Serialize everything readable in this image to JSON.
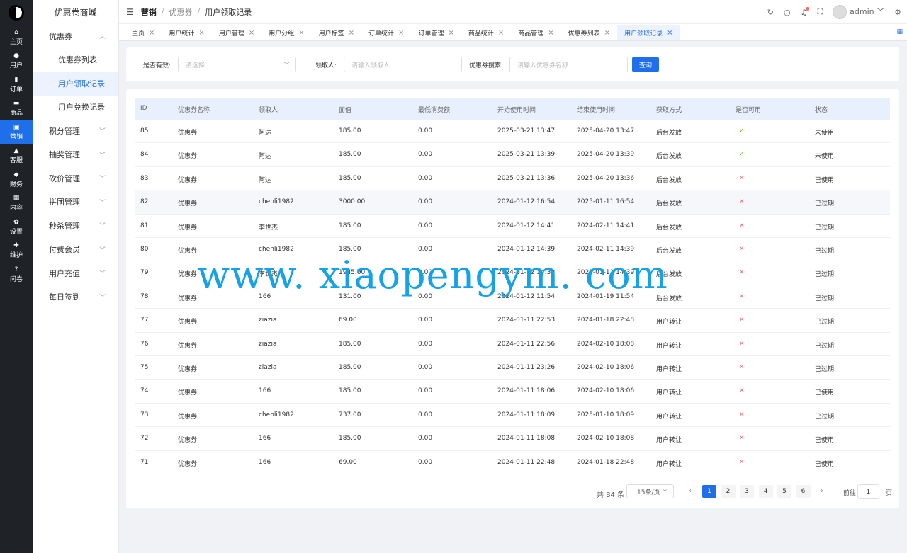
{
  "app": {
    "name": "优惠卷商城"
  },
  "rail": [
    {
      "label": "主页",
      "icon": "home-icon",
      "glyph": "⌂"
    },
    {
      "label": "用户",
      "icon": "user-icon",
      "glyph": "●"
    },
    {
      "label": "订单",
      "icon": "order-icon",
      "glyph": "▮"
    },
    {
      "label": "商品",
      "icon": "product-icon",
      "glyph": "▬"
    },
    {
      "label": "营销",
      "icon": "marketing-icon",
      "glyph": "▣"
    },
    {
      "label": "客服",
      "icon": "service-icon",
      "glyph": "▲"
    },
    {
      "label": "财务",
      "icon": "finance-icon",
      "glyph": "◆"
    },
    {
      "label": "内容",
      "icon": "content-icon",
      "glyph": "▦"
    },
    {
      "label": "设置",
      "icon": "settings-icon",
      "glyph": "✿"
    },
    {
      "label": "维护",
      "icon": "maintenance-icon",
      "glyph": "✚"
    },
    {
      "label": "问卷",
      "icon": "survey-icon",
      "glyph": "?"
    }
  ],
  "submenu": {
    "group_open": "优惠券",
    "children": [
      "优惠券列表",
      "用户领取记录",
      "用户兑换记录"
    ],
    "groups": [
      "积分管理",
      "抽奖管理",
      "砍价管理",
      "拼团管理",
      "秒杀管理",
      "付费会员",
      "用户充值",
      "每日签到"
    ]
  },
  "header": {
    "breadcrumb": [
      "营销",
      "优惠券",
      "用户领取记录"
    ],
    "user": "admin"
  },
  "tabs": [
    "主页",
    "用户统计",
    "用户管理",
    "用户分组",
    "用户标签",
    "订单统计",
    "订单管理",
    "商品统计",
    "商品管理",
    "优惠券列表",
    "用户领取记录"
  ],
  "filter": {
    "valid_label": "是否有效:",
    "valid_placeholder": "请选择",
    "receiver_label": "领取人:",
    "receiver_placeholder": "请输入领取人",
    "coupon_label": "优惠券搜索:",
    "coupon_placeholder": "请输入优惠券名称",
    "query_button": "查询"
  },
  "table": {
    "columns": [
      "ID",
      "优惠券名称",
      "领取人",
      "面值",
      "最低消费额",
      "开始使用时间",
      "结束使用时间",
      "获取方式",
      "是否可用",
      "状态"
    ],
    "rows": [
      [
        "85",
        "优惠券",
        "阿达",
        "185.00",
        "0.00",
        "2025-03-21 13:47",
        "2025-04-20 13:47",
        "后台发放",
        "✓",
        "未使用"
      ],
      [
        "84",
        "优惠券",
        "阿达",
        "185.00",
        "0.00",
        "2025-03-21 13:39",
        "2025-04-20 13:39",
        "后台发放",
        "✓",
        "未使用"
      ],
      [
        "83",
        "优惠券",
        "阿达",
        "185.00",
        "0.00",
        "2025-03-21 13:36",
        "2025-04-20 13:36",
        "后台发放",
        "✕",
        "已使用"
      ],
      [
        "82",
        "优惠券",
        "chenli1982",
        "3000.00",
        "0.00",
        "2024-01-12 16:54",
        "2025-01-11 16:54",
        "后台发放",
        "✕",
        "已过期"
      ],
      [
        "81",
        "优惠券",
        "李世杰",
        "185.00",
        "0.00",
        "2024-01-12 14:41",
        "2024-02-11 14:41",
        "后台发放",
        "✕",
        "已过期"
      ],
      [
        "80",
        "优惠券",
        "chenli1982",
        "185.00",
        "0.00",
        "2024-01-12 14:39",
        "2024-02-11 14:39",
        "后台发放",
        "✕",
        "已过期"
      ],
      [
        "79",
        "优惠券",
        "李世杰",
        "1945.00",
        "0.00",
        "2024-01-12 14:39",
        "2025-01-11 14:39",
        "后台发放",
        "✕",
        "已过期"
      ],
      [
        "78",
        "优惠券",
        "166",
        "131.00",
        "0.00",
        "2024-01-12 11:54",
        "2024-01-19 11:54",
        "后台发放",
        "✕",
        "已过期"
      ],
      [
        "77",
        "优惠券",
        "ziazia",
        "69.00",
        "0.00",
        "2024-01-11 22:53",
        "2024-01-18 22:48",
        "用户转让",
        "✕",
        "已过期"
      ],
      [
        "76",
        "优惠券",
        "ziazia",
        "185.00",
        "0.00",
        "2024-01-11 22:56",
        "2024-02-10 18:08",
        "用户转让",
        "✕",
        "已过期"
      ],
      [
        "75",
        "优惠券",
        "ziazia",
        "185.00",
        "0.00",
        "2024-01-11 23:26",
        "2024-02-10 18:06",
        "用户转让",
        "✕",
        "已过期"
      ],
      [
        "74",
        "优惠券",
        "166",
        "185.00",
        "0.00",
        "2024-01-11 18:06",
        "2024-02-10 18:06",
        "用户转让",
        "✕",
        "已使用"
      ],
      [
        "73",
        "优惠券",
        "chenli1982",
        "737.00",
        "0.00",
        "2024-01-11 18:09",
        "2025-01-10 18:09",
        "用户转让",
        "✕",
        "已过期"
      ],
      [
        "72",
        "优惠券",
        "166",
        "185.00",
        "0.00",
        "2024-01-11 18:08",
        "2024-02-10 18:08",
        "用户转让",
        "✕",
        "已使用"
      ],
      [
        "71",
        "优惠券",
        "166",
        "69.00",
        "0.00",
        "2024-01-11 22:48",
        "2024-01-18 22:48",
        "用户转让",
        "✕",
        "已使用"
      ]
    ]
  },
  "pagination": {
    "total": "共 84 条",
    "page_size": "15条/页",
    "pages": [
      "1",
      "2",
      "3",
      "4",
      "5",
      "6"
    ],
    "current": "1",
    "goto_label": "前往",
    "goto_value": "1",
    "goto_unit": "页"
  },
  "watermark": "www. xiaopengym. com",
  "colors": {
    "primary": "#1f6feb",
    "rail_bg": "#1f2227",
    "ok": "#52c41a",
    "no": "#f56c6c"
  }
}
